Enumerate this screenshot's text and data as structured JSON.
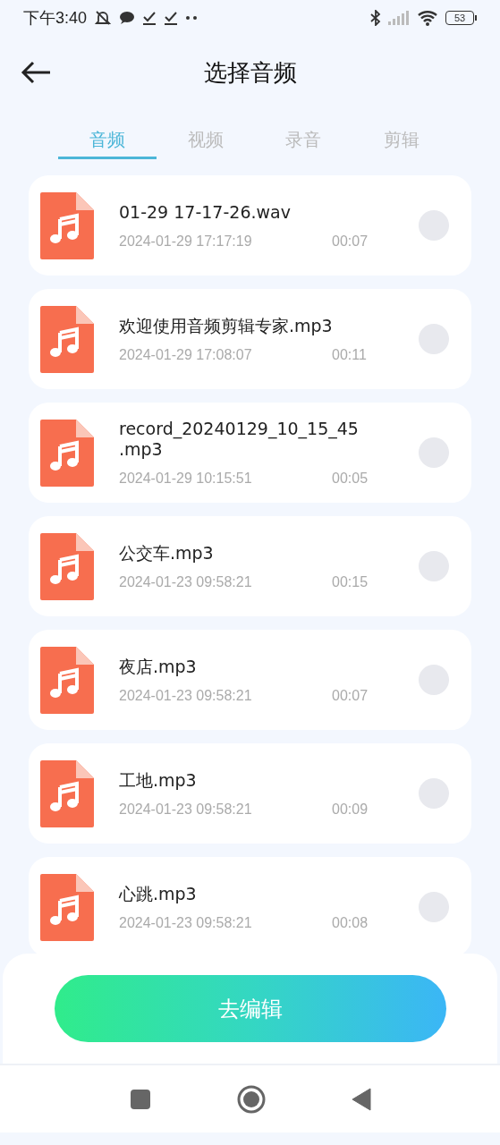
{
  "status_bar": {
    "time": "下午3:40",
    "battery": "53"
  },
  "header": {
    "title": "选择音频"
  },
  "tabs": [
    {
      "label": "音频",
      "selected": true
    },
    {
      "label": "视频",
      "selected": false
    },
    {
      "label": "录音",
      "selected": false
    },
    {
      "label": "剪辑",
      "selected": false
    }
  ],
  "files": [
    {
      "name": "01-29 17-17-26.wav",
      "date": "2024-01-29 17:17:19",
      "duration": "00:07",
      "selected": false
    },
    {
      "name": "欢迎使用音频剪辑专家.mp3",
      "date": "2024-01-29 17:08:07",
      "duration": "00:11",
      "selected": false
    },
    {
      "name": "record_20240129_10_15_45.mp3",
      "date": "2024-01-29 10:15:51",
      "duration": "00:05",
      "selected": false
    },
    {
      "name": "公交车.mp3",
      "date": "2024-01-23 09:58:21",
      "duration": "00:15",
      "selected": false
    },
    {
      "name": "夜店.mp3",
      "date": "2024-01-23 09:58:21",
      "duration": "00:07",
      "selected": false
    },
    {
      "name": "工地.mp3",
      "date": "2024-01-23 09:58:21",
      "duration": "00:09",
      "selected": false
    },
    {
      "name": "心跳.mp3",
      "date": "2024-01-23 09:58:21",
      "duration": "00:08",
      "selected": false
    }
  ],
  "edit_button": {
    "label": "去编辑"
  }
}
